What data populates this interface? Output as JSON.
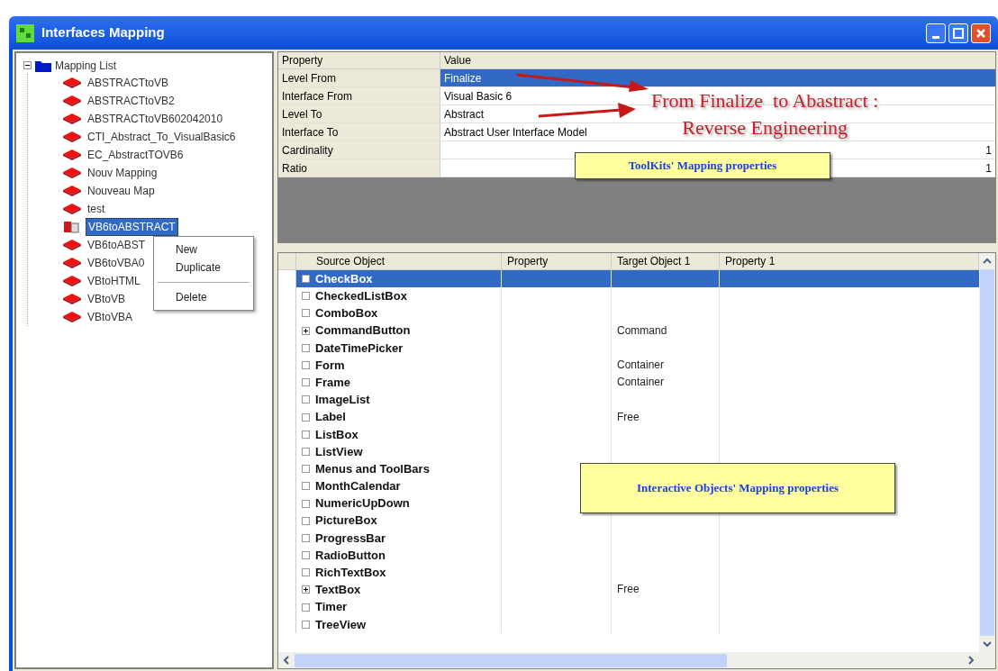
{
  "window": {
    "title": "Interfaces Mapping"
  },
  "tree": {
    "label": "Mapping List",
    "expanded": true,
    "children": [
      {
        "label": "ABSTRACTtoVB",
        "selected": false
      },
      {
        "label": "ABSTRACTtoVB2",
        "selected": false
      },
      {
        "label": "ABSTRACTtoVB602042010",
        "selected": false
      },
      {
        "label": "CTI_Abstract_To_VisualBasic6",
        "selected": false
      },
      {
        "label": "EC_AbstractTOVB6",
        "selected": false
      },
      {
        "label": "Nouv Mapping",
        "selected": false
      },
      {
        "label": "Nouveau Map",
        "selected": false
      },
      {
        "label": "test",
        "selected": false
      },
      {
        "label": "VB6toABSTRACT",
        "selected": true
      },
      {
        "label": "VB6toABST",
        "selected": false
      },
      {
        "label": "VB6toVBA0",
        "selected": false
      },
      {
        "label": "VBtoHTML",
        "selected": false
      },
      {
        "label": "VBtoVB",
        "selected": false
      },
      {
        "label": "VBtoVBA",
        "selected": false
      }
    ]
  },
  "context_menu": {
    "items": [
      {
        "kind": "item",
        "label": "New"
      },
      {
        "kind": "item",
        "label": "Duplicate"
      },
      {
        "kind": "separator"
      },
      {
        "kind": "item",
        "label": "Delete"
      }
    ]
  },
  "properties": {
    "columns": [
      "Property",
      "Value"
    ],
    "rows": [
      {
        "kind": "text",
        "name": "Level From",
        "value": "Finalize",
        "selected": true
      },
      {
        "kind": "text",
        "name": "Interface From",
        "value": "Visual Basic 6",
        "selected": false
      },
      {
        "kind": "text",
        "name": "Level To",
        "value": "Abstract",
        "selected": false
      },
      {
        "kind": "text",
        "name": "Interface To",
        "value": "Abstract User Interface Model",
        "selected": false
      },
      {
        "kind": "number",
        "name": "Cardinality",
        "value": "1",
        "selected": false
      },
      {
        "kind": "number",
        "name": "Ratio",
        "value": "1",
        "selected": false
      }
    ]
  },
  "annotation": {
    "lines": [
      "From Finalize  to Abastract :",
      "Reverse Engineering"
    ]
  },
  "callouts": [
    "ToolKits' Mapping properties",
    "Interactive Objects' Mapping properties"
  ],
  "objects": {
    "columns": [
      "Source Object",
      "Property",
      "Target Object 1",
      "Property 1"
    ],
    "rows": [
      {
        "kind": "box",
        "source": "CheckBox",
        "selected": true,
        "checked": false
      },
      {
        "kind": "box",
        "source": "CheckedListBox",
        "selected": false,
        "checked": false
      },
      {
        "kind": "box",
        "source": "ComboBox",
        "selected": false,
        "checked": false
      },
      {
        "kind": "plus",
        "source": "CommandButton",
        "target": "Command",
        "selected": false,
        "expanded": false
      },
      {
        "kind": "box",
        "source": "DateTimePicker",
        "selected": false,
        "checked": false
      },
      {
        "kind": "box",
        "source": "Form",
        "target": "Container",
        "selected": false,
        "checked": false
      },
      {
        "kind": "box",
        "source": "Frame",
        "target": "Container",
        "selected": false,
        "checked": false
      },
      {
        "kind": "box",
        "source": "ImageList",
        "selected": false,
        "checked": false
      },
      {
        "kind": "box",
        "source": "Label",
        "target": "Free",
        "selected": false,
        "checked": false
      },
      {
        "kind": "box",
        "source": "ListBox",
        "selected": false,
        "checked": false
      },
      {
        "kind": "box",
        "source": "ListView",
        "selected": false,
        "checked": false
      },
      {
        "kind": "box",
        "source": "Menus and ToolBars",
        "selected": false,
        "checked": false
      },
      {
        "kind": "box",
        "source": "MonthCalendar",
        "selected": false,
        "checked": false
      },
      {
        "kind": "box",
        "source": "NumericUpDown",
        "selected": false,
        "checked": false
      },
      {
        "kind": "box",
        "source": "PictureBox",
        "selected": false,
        "checked": false
      },
      {
        "kind": "box",
        "source": "ProgressBar",
        "selected": false,
        "checked": false
      },
      {
        "kind": "box",
        "source": "RadioButton",
        "selected": false,
        "checked": false
      },
      {
        "kind": "box",
        "source": "RichTextBox",
        "selected": false,
        "checked": false
      },
      {
        "kind": "plus",
        "source": "TextBox",
        "target": "Free",
        "selected": false,
        "expanded": false
      },
      {
        "kind": "box",
        "source": "Timer",
        "selected": false,
        "checked": false
      },
      {
        "kind": "box",
        "source": "TreeView",
        "selected": false,
        "checked": false
      }
    ]
  }
}
